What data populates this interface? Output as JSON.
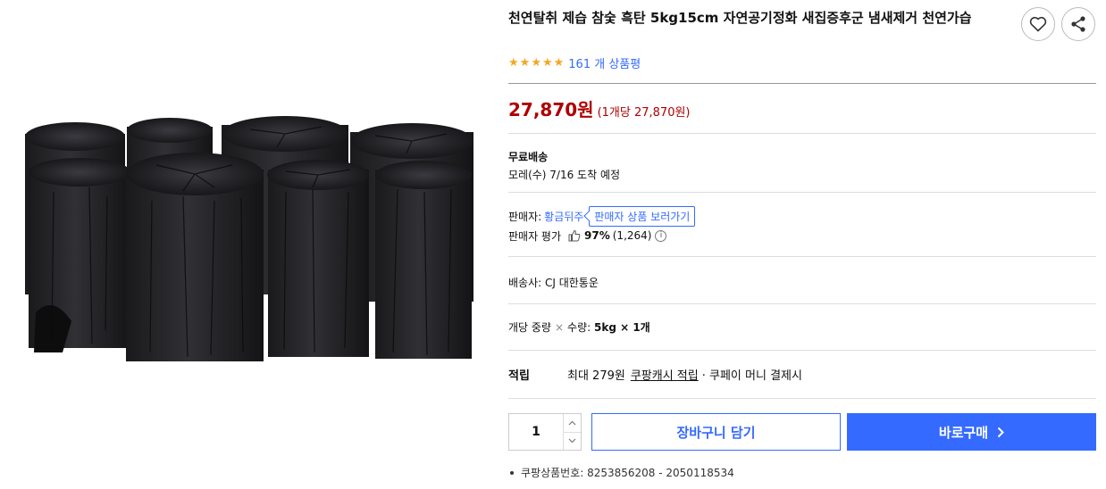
{
  "product": {
    "title": "천연탈취 제습 참숯 흑탄 5kg15cm 자연공기정화 새집증후군 냄새제거 천연가습",
    "image_alt": "black charcoal logs"
  },
  "rating": {
    "stars": 5,
    "review_text": "161 개 상품평"
  },
  "price": {
    "main": "27,870원",
    "unit": "(1개당 27,870원)"
  },
  "shipping": {
    "title": "무료배송",
    "arrival": "모레(수) 7/16 도착 예정"
  },
  "seller": {
    "label": "판매자:",
    "name": "황금뒤주",
    "view_button": "판매자 상품 보러가기",
    "rating_label": "판매자 평가",
    "rating_percent": "97%",
    "rating_count": "(1,264)",
    "info_icon": "i"
  },
  "carrier": {
    "text": "배송사:  CJ 대한통운"
  },
  "weight": {
    "prefix": "개당 중량",
    "mid": "수량:",
    "value": "5kg × 1개"
  },
  "reward": {
    "label": "적립",
    "prefix": "최대 279원",
    "link": "쿠팡캐시 적립",
    "suffix": "· 쿠페이 머니 결제시"
  },
  "purchase": {
    "quantity": "1",
    "cart_label": "장바구니 담기",
    "buy_label": "바로구매"
  },
  "product_number": {
    "text": "쿠팡상품번호: 8253856208 - 2050118534"
  },
  "icons": [
    "heart-icon",
    "share-icon",
    "star-icon",
    "thumbs-up-icon",
    "info-icon",
    "chevron-up-icon",
    "chevron-down-icon",
    "chevron-right-icon"
  ],
  "colors": {
    "accent": "#346aff",
    "price": "#ae0000",
    "star": "#f5a623"
  }
}
